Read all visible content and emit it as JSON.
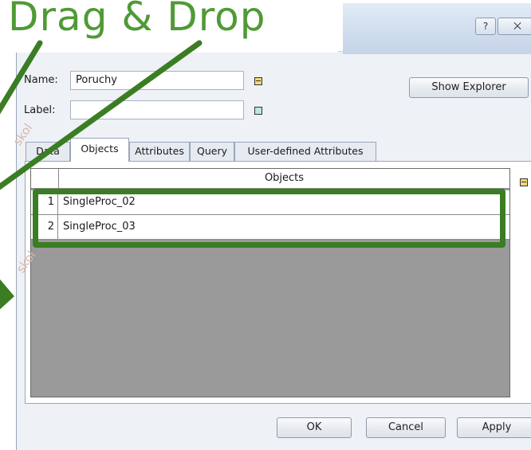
{
  "heading": "Drag & Drop",
  "titlebar": {
    "help_glyph": "?",
    "close_glyph": "⨉"
  },
  "form": {
    "name_label": "Name:",
    "name_value": "Poruchy",
    "label_label": "Label:",
    "label_value": "",
    "show_explorer": "Show Explorer"
  },
  "tabs": [
    "Data",
    "Objects",
    "Attributes",
    "Query",
    "User-defined Attributes"
  ],
  "active_tab": "Objects",
  "table": {
    "column_header": "Objects",
    "rows": [
      {
        "num": "1",
        "value": "SingleProc_02"
      },
      {
        "num": "2",
        "value": "SingleProc_03"
      }
    ]
  },
  "footer": {
    "ok": "OK",
    "cancel": "Cancel",
    "apply": "Apply"
  },
  "colors": {
    "accent_green": "#3a7d23",
    "heading_green": "#4f9a35",
    "grid_gray": "#9a9a9a"
  },
  "watermark": "skol"
}
